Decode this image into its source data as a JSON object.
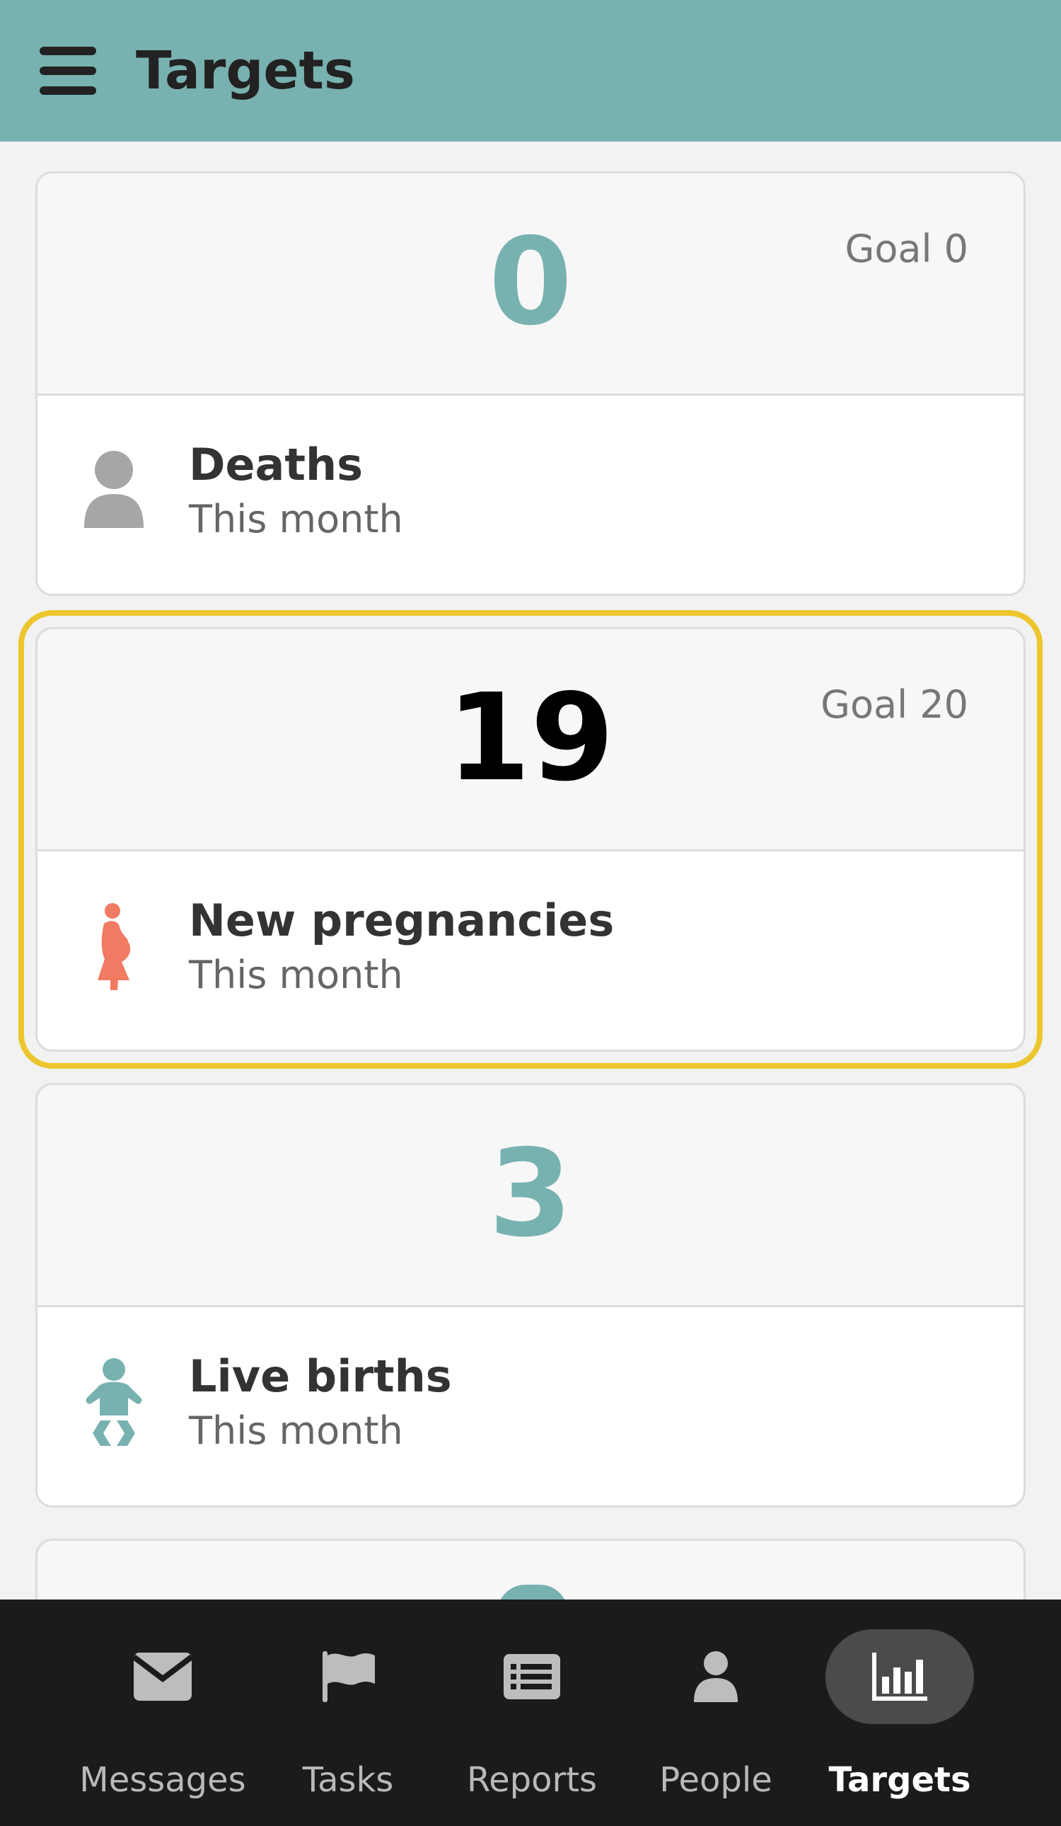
{
  "header": {
    "title": "Targets",
    "menu_icon": "hamburger-menu-icon",
    "background": "#78b2b0"
  },
  "targets": [
    {
      "value": "0",
      "goal": "Goal 0",
      "title": "Deaths",
      "period": "This month",
      "icon": "person-icon",
      "value_color": "#78b2b0",
      "icon_color": "#a6a6a6",
      "selected": false
    },
    {
      "value": "19",
      "goal": "Goal 20",
      "title": "New pregnancies",
      "period": "This month",
      "icon": "pregnant-woman-icon",
      "value_color": "#000000",
      "icon_color": "#f17a62",
      "selected": true
    },
    {
      "value": "3",
      "goal": "",
      "title": "Live births",
      "period": "This month",
      "icon": "baby-icon",
      "value_color": "#78b2b0",
      "icon_color": "#78b2b0",
      "selected": false
    }
  ],
  "bottom_nav": {
    "items": [
      {
        "label": "Messages",
        "icon": "envelope-icon",
        "active": false
      },
      {
        "label": "Tasks",
        "icon": "flag-icon",
        "active": false
      },
      {
        "label": "Reports",
        "icon": "list-icon",
        "active": false
      },
      {
        "label": "People",
        "icon": "person-icon",
        "active": false
      },
      {
        "label": "Targets",
        "icon": "bar-chart-icon",
        "active": true
      }
    ]
  },
  "colors": {
    "highlight_outline": "#ecc62c",
    "nav_background": "#1b1b1b",
    "active_nav_pill": "#4b4b4b"
  }
}
